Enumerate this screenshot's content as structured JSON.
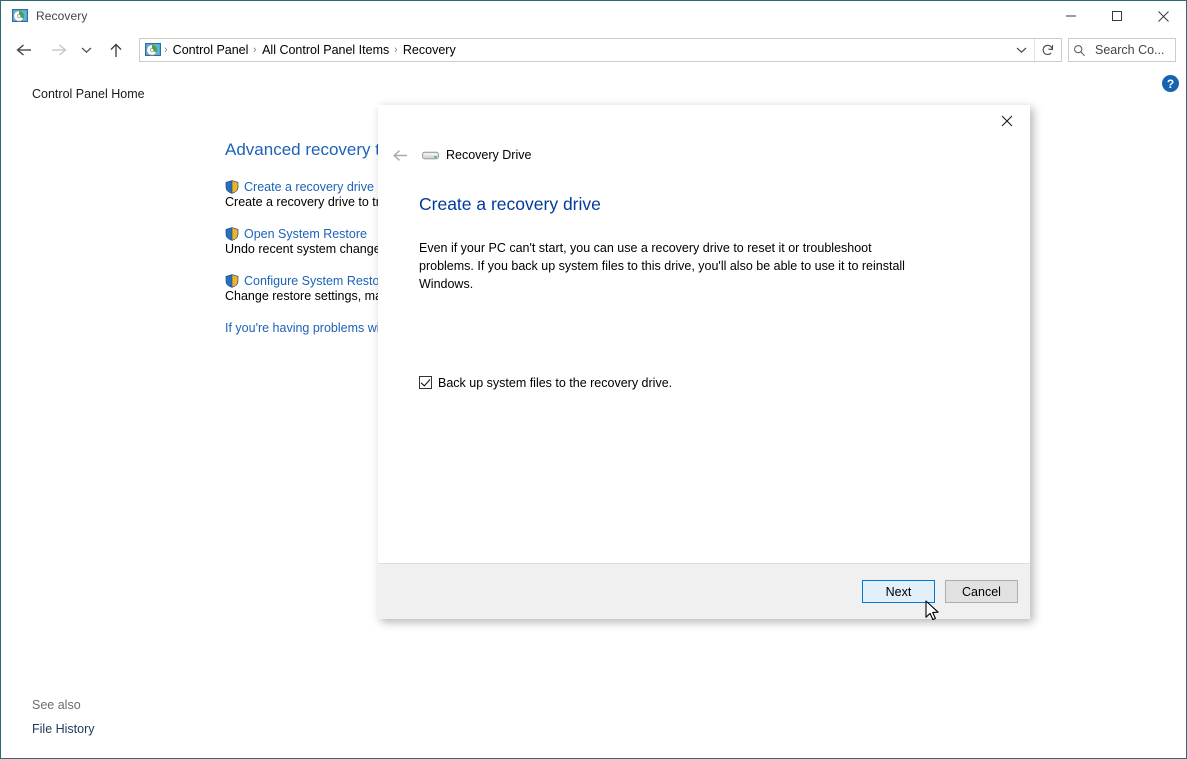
{
  "window": {
    "title": "Recovery",
    "icon": "recovery-icon",
    "controls": {
      "minimize": "minimize-icon",
      "maximize": "maximize-icon",
      "close": "close-icon"
    }
  },
  "navbar": {
    "back": "back-arrow-icon",
    "forward": "forward-arrow-icon",
    "recent": "recent-locations-chevron-icon",
    "up": "up-arrow-icon",
    "breadcrumbs": [
      "Control Panel",
      "All Control Panel Items",
      "Recovery"
    ],
    "separator": "›",
    "dropdown": "address-dropdown-chevron-icon",
    "refresh": "refresh-icon",
    "search": {
      "icon": "search-icon",
      "value": "Search Co...",
      "placeholder": "Search Control Panel"
    }
  },
  "sidebar": {
    "home_label": "Control Panel Home",
    "see_also_label": "See also",
    "see_also_items": [
      "File History"
    ]
  },
  "content": {
    "heading": "Advanced recovery tools",
    "help_label": "?",
    "tasks": [
      {
        "link": "Create a recovery drive",
        "description": "Create a recovery drive to tro",
        "icon": "uac-shield-icon"
      },
      {
        "link": "Open System Restore",
        "description": "Undo recent system changes,",
        "icon": "uac-shield-icon"
      },
      {
        "link": "Configure System Restore",
        "description": "Change restore settings, man",
        "icon": "uac-shield-icon"
      }
    ],
    "trouble_link": "If you're having problems wit"
  },
  "dialog": {
    "close": "close-icon",
    "back": "back-arrow-icon",
    "app_icon": "recovery-drive-icon",
    "app_title": "Recovery Drive",
    "heading": "Create a recovery drive",
    "body": "Even if your PC can't start, you can use a recovery drive to reset it or troubleshoot problems. If you back up system files to this drive, you'll also be able to use it to reinstall Windows.",
    "checkbox": {
      "label": "Back up system files to the recovery drive.",
      "checked": true
    },
    "buttons": {
      "next": "Next",
      "cancel": "Cancel"
    }
  },
  "colors": {
    "window_border": "#2b6b72",
    "link_blue": "#1c62b9",
    "dialog_heading_blue": "#003a9b",
    "accent_button_border": "#0078d7",
    "accent_button_fill": "#e2f0fb",
    "help_badge": "#1664b0",
    "footer_bg": "#f0f0f0"
  }
}
